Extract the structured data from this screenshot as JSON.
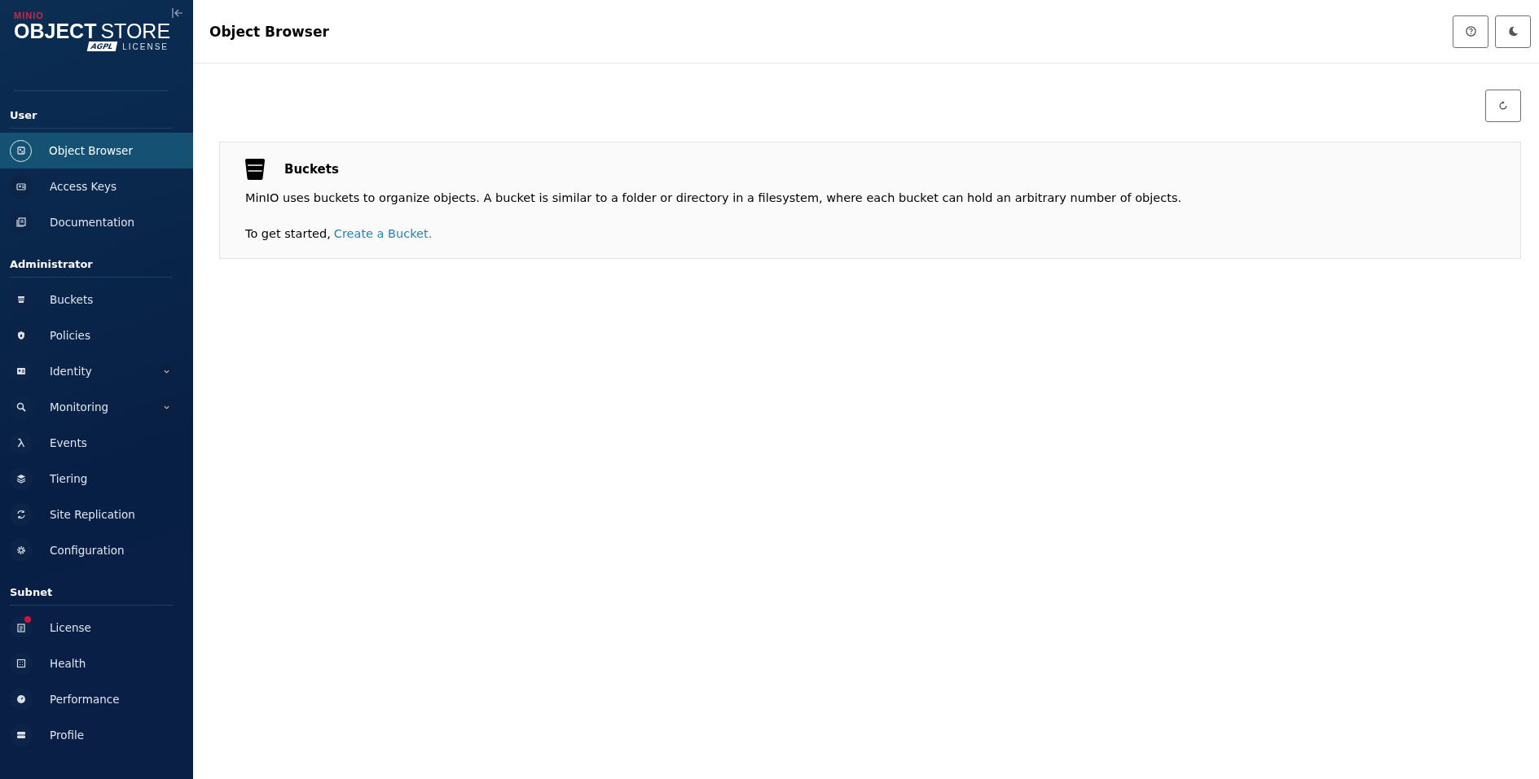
{
  "logo": {
    "brand": "MINIO",
    "product_bold": "OBJECT",
    "product_light": "STORE",
    "license_badge": "AGPL",
    "license": "LICENSE"
  },
  "sidebar": {
    "sections": [
      {
        "title": "User",
        "items": [
          {
            "label": "Object Browser",
            "kind": "browser",
            "selected": true
          },
          {
            "label": "Access Keys",
            "kind": "keys",
            "selected": false
          },
          {
            "label": "Documentation",
            "kind": "docs",
            "selected": false
          }
        ]
      },
      {
        "title": "Administrator",
        "items": [
          {
            "label": "Buckets",
            "kind": "bucket",
            "selected": false
          },
          {
            "label": "Policies",
            "kind": "policy",
            "selected": false
          },
          {
            "label": "Identity",
            "kind": "identity",
            "selected": false,
            "expanded": false
          },
          {
            "label": "Monitoring",
            "kind": "monitor",
            "selected": false,
            "expanded": false
          },
          {
            "label": "Events",
            "kind": "lambda",
            "selected": false
          },
          {
            "label": "Tiering",
            "kind": "layers",
            "selected": false
          },
          {
            "label": "Site Replication",
            "kind": "sync",
            "selected": false
          },
          {
            "label": "Configuration",
            "kind": "gear",
            "selected": false
          }
        ]
      },
      {
        "title": "Subnet",
        "items": [
          {
            "label": "License",
            "kind": "license",
            "selected": false,
            "alert": true
          },
          {
            "label": "Health",
            "kind": "health",
            "selected": false
          },
          {
            "label": "Performance",
            "kind": "gauge",
            "selected": false
          },
          {
            "label": "Profile",
            "kind": "profile",
            "selected": false
          }
        ]
      }
    ]
  },
  "header": {
    "title": "Object Browser"
  },
  "card": {
    "title": "Buckets",
    "description": "MinIO uses buckets to organize objects. A bucket is similar to a folder or directory in a filesystem, where each bucket can hold an arbitrary number of objects.",
    "prompt": "To get started,",
    "link": "Create a Bucket."
  }
}
